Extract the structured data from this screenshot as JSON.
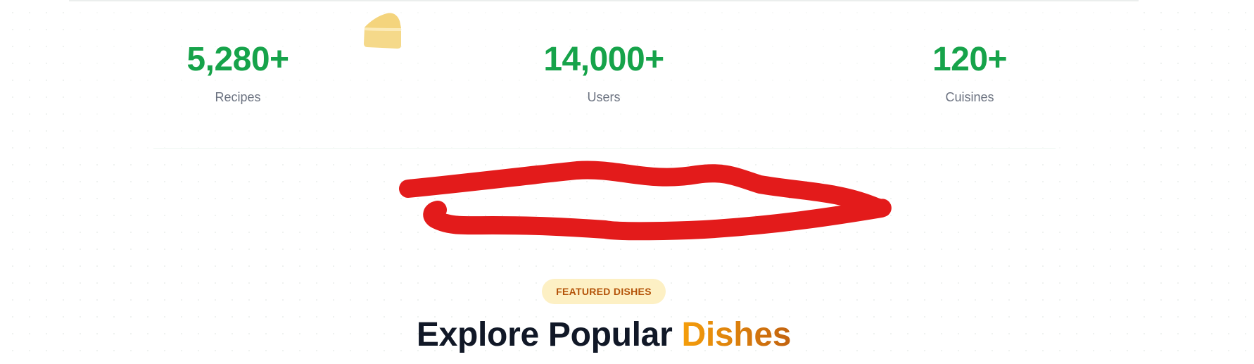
{
  "stats": [
    {
      "value": "5,280+",
      "label": "Recipes"
    },
    {
      "value": "14,000+",
      "label": "Users"
    },
    {
      "value": "120+",
      "label": "Cuisines"
    }
  ],
  "decor": {
    "floating_icon": "cheese-icon",
    "annotation": "red-scribble"
  },
  "featured": {
    "badge": "FEATURED DISHES",
    "title_main": "Explore Popular",
    "title_accent": "Dishes"
  },
  "colors": {
    "stat_value": "#16a34a",
    "stat_label": "#6b7280",
    "badge_bg": "#fdf0c4",
    "badge_text": "#b45309",
    "title": "#111827",
    "accent_start": "#f59e0b",
    "accent_end": "#c2620f",
    "scribble": "#e31b1b",
    "cheese": "#f5d98a"
  }
}
